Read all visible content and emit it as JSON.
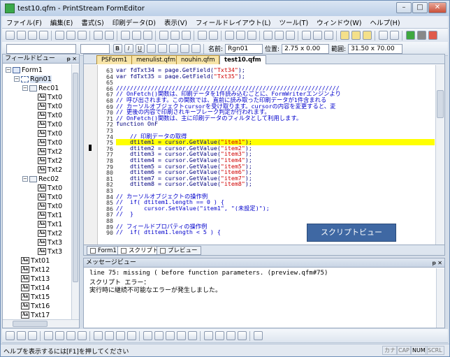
{
  "window": {
    "title": "test10.qfm - PrintStream FormEditor",
    "minimize": "–",
    "maximize": "□",
    "close": "✕"
  },
  "menu": [
    "ファイル(F)",
    "編集(E)",
    "書式(S)",
    "印刷データ(D)",
    "表示(V)",
    "フィールドレイアウト(L)",
    "ツール(T)",
    "ウィンドウ(W)",
    "ヘルプ(H)"
  ],
  "format_bar": {
    "bold": "B",
    "italic": "I",
    "underline": "U",
    "name_label": "名前:",
    "name_value": "Rgn01",
    "position_label": "位置:",
    "position_value": "2.75 x 0.00",
    "range_label": "範囲:",
    "range_value": "31.50 x 70.00"
  },
  "field_view": {
    "title": "フィールドビュー",
    "pin": "ᵽ",
    "close": "✕",
    "tree": [
      {
        "label": "Form1",
        "level": 0,
        "type": "form",
        "expander": "−"
      },
      {
        "label": "Rgn01",
        "level": 1,
        "type": "rgn",
        "expander": "−"
      },
      {
        "label": "Rec01",
        "level": 2,
        "type": "rec",
        "expander": "−"
      },
      {
        "label": "Txt0",
        "level": 3,
        "type": "txt"
      },
      {
        "label": "Txt0",
        "level": 3,
        "type": "txt"
      },
      {
        "label": "Txt0",
        "level": 3,
        "type": "txt"
      },
      {
        "label": "Txt0",
        "level": 3,
        "type": "txt"
      },
      {
        "label": "Txt0",
        "level": 3,
        "type": "txt"
      },
      {
        "label": "Txt0",
        "level": 3,
        "type": "txt"
      },
      {
        "label": "Txt2",
        "level": 3,
        "type": "txt"
      },
      {
        "label": "Txt2",
        "level": 3,
        "type": "txt"
      },
      {
        "label": "Txt2",
        "level": 3,
        "type": "txt"
      },
      {
        "label": "Rec02",
        "level": 2,
        "type": "rec",
        "expander": "−"
      },
      {
        "label": "Txt0",
        "level": 3,
        "type": "txt"
      },
      {
        "label": "Txt0",
        "level": 3,
        "type": "txt"
      },
      {
        "label": "Txt0",
        "level": 3,
        "type": "txt"
      },
      {
        "label": "Txt1",
        "level": 3,
        "type": "txt"
      },
      {
        "label": "Txt1",
        "level": 3,
        "type": "txt"
      },
      {
        "label": "Txt2",
        "level": 3,
        "type": "txt"
      },
      {
        "label": "Txt3",
        "level": 3,
        "type": "txt"
      },
      {
        "label": "Txt3",
        "level": 3,
        "type": "txt"
      },
      {
        "label": "Txt01",
        "level": 1,
        "type": "txt"
      },
      {
        "label": "Txt12",
        "level": 1,
        "type": "txt"
      },
      {
        "label": "Txt13",
        "level": 1,
        "type": "txt"
      },
      {
        "label": "Txt14",
        "level": 1,
        "type": "txt"
      },
      {
        "label": "Txt15",
        "level": 1,
        "type": "txt"
      },
      {
        "label": "Txt16",
        "level": 1,
        "type": "txt"
      },
      {
        "label": "Txt17",
        "level": 1,
        "type": "txt"
      },
      {
        "label": "Txt18",
        "level": 1,
        "type": "txt"
      }
    ]
  },
  "doc_tabs": [
    {
      "label": "PSForm1",
      "active": false
    },
    {
      "label": "menulist.qfm",
      "active": false
    },
    {
      "label": "nouhin.qfm",
      "active": false
    },
    {
      "label": "test10.qfm",
      "active": true
    }
  ],
  "editor": {
    "highlight_line": 75,
    "lines": [
      {
        "n": 63,
        "text": "var fdTxt34 = page.GetField(",
        "str": "\"Txt34\"",
        "tail": ");",
        "kind": "code"
      },
      {
        "n": 64,
        "text": "var fdTxt35 = page.GetField(",
        "str": "\"Txt35\"",
        "tail": ");",
        "kind": "code"
      },
      {
        "n": 65,
        "text": "",
        "kind": "code"
      },
      {
        "n": 66,
        "text": "////////////////////////////////////////////////////////////////",
        "kind": "comment"
      },
      {
        "n": 67,
        "text": "// OnFetch()関数は、印刷データを1件読み込むごとに、FormWriterエンジンより",
        "kind": "comment"
      },
      {
        "n": 68,
        "text": "// 呼び出されます。この関数では、直前に読み取った印刷データが1件含まれる",
        "kind": "comment"
      },
      {
        "n": 69,
        "text": "// カーソルオブジェクトcursorを受け取ります。cursorの内容を変更すると、変",
        "kind": "comment"
      },
      {
        "n": 70,
        "text": "// 更後の内容で印刷されキーブレーク判定が行われます。",
        "kind": "comment"
      },
      {
        "n": 71,
        "text": "// OnFetch()関数は、主に印刷データのフィルタとして利用します。",
        "kind": "comment"
      },
      {
        "n": 72,
        "text": "function OnF",
        "kind": "keyword"
      },
      {
        "n": 73,
        "text": "",
        "kind": "code"
      },
      {
        "n": 74,
        "text": "    // 印刷データの取得",
        "kind": "comment"
      },
      {
        "n": 75,
        "text": "    dtitem1 = cursor.GetValue(",
        "str": "\"item1\"",
        "tail": ");",
        "kind": "code"
      },
      {
        "n": 76,
        "text": "    dtitem2 = cursor.GetValue(",
        "str": "\"item2\"",
        "tail": ");",
        "kind": "code"
      },
      {
        "n": 77,
        "text": "    dtitem3 = cursor.GetValue(",
        "str": "\"item3\"",
        "tail": ");",
        "kind": "code"
      },
      {
        "n": 78,
        "text": "    dtitem4 = cursor.GetValue(",
        "str": "\"item4\"",
        "tail": ");",
        "kind": "code"
      },
      {
        "n": 79,
        "text": "    dtitem5 = cursor.GetValue(",
        "str": "\"item5\"",
        "tail": ");",
        "kind": "code"
      },
      {
        "n": 80,
        "text": "    dtitem6 = cursor.GetValue(",
        "str": "\"item6\"",
        "tail": ");",
        "kind": "code"
      },
      {
        "n": 81,
        "text": "    dtitem7 = cursor.GetValue(",
        "str": "\"item7\"",
        "tail": ");",
        "kind": "code"
      },
      {
        "n": 82,
        "text": "    dtitem8 = cursor.GetValue(",
        "str": "\"item8\"",
        "tail": ");",
        "kind": "code"
      },
      {
        "n": 83,
        "text": "",
        "kind": "code"
      },
      {
        "n": 84,
        "text": "// カーソルオブジェクトの操作例",
        "kind": "comment"
      },
      {
        "n": 85,
        "text": "//  if( dtitem1.length == 0 ) {",
        "kind": "comment"
      },
      {
        "n": 86,
        "text": "//      cursor.SetValue(\"item1\", \"(未設定)\");",
        "kind": "comment"
      },
      {
        "n": 87,
        "text": "//  }",
        "kind": "comment"
      },
      {
        "n": 88,
        "text": "",
        "kind": "code"
      },
      {
        "n": 89,
        "text": "// フィールドプロパティの操作例",
        "kind": "comment"
      },
      {
        "n": 90,
        "text": "//  if( dtitem1.length < 5 ) {",
        "kind": "comment"
      }
    ]
  },
  "callout": "スクリプトビュー",
  "bottom_tabs": [
    {
      "label": "Form1",
      "active": false
    },
    {
      "label": "スクリプト",
      "active": true
    },
    {
      "label": "プレビュー",
      "active": false
    }
  ],
  "message_view": {
    "title": "メッセージビュー",
    "pin": "ᵽ",
    "close": "✕",
    "lines": [
      "line 75: missing ( before function parameters. (preview.qfm#75)",
      "スクリプト エラー：",
      "実行時に継続不可能なエラーが発生しました。"
    ]
  },
  "status": {
    "text": "ヘルプを表示するには[F1]を押してください",
    "indicators": [
      {
        "label": "カナ",
        "on": false
      },
      {
        "label": "CAP",
        "on": false
      },
      {
        "label": "NUM",
        "on": true
      },
      {
        "label": "SCRL",
        "on": false
      }
    ]
  }
}
